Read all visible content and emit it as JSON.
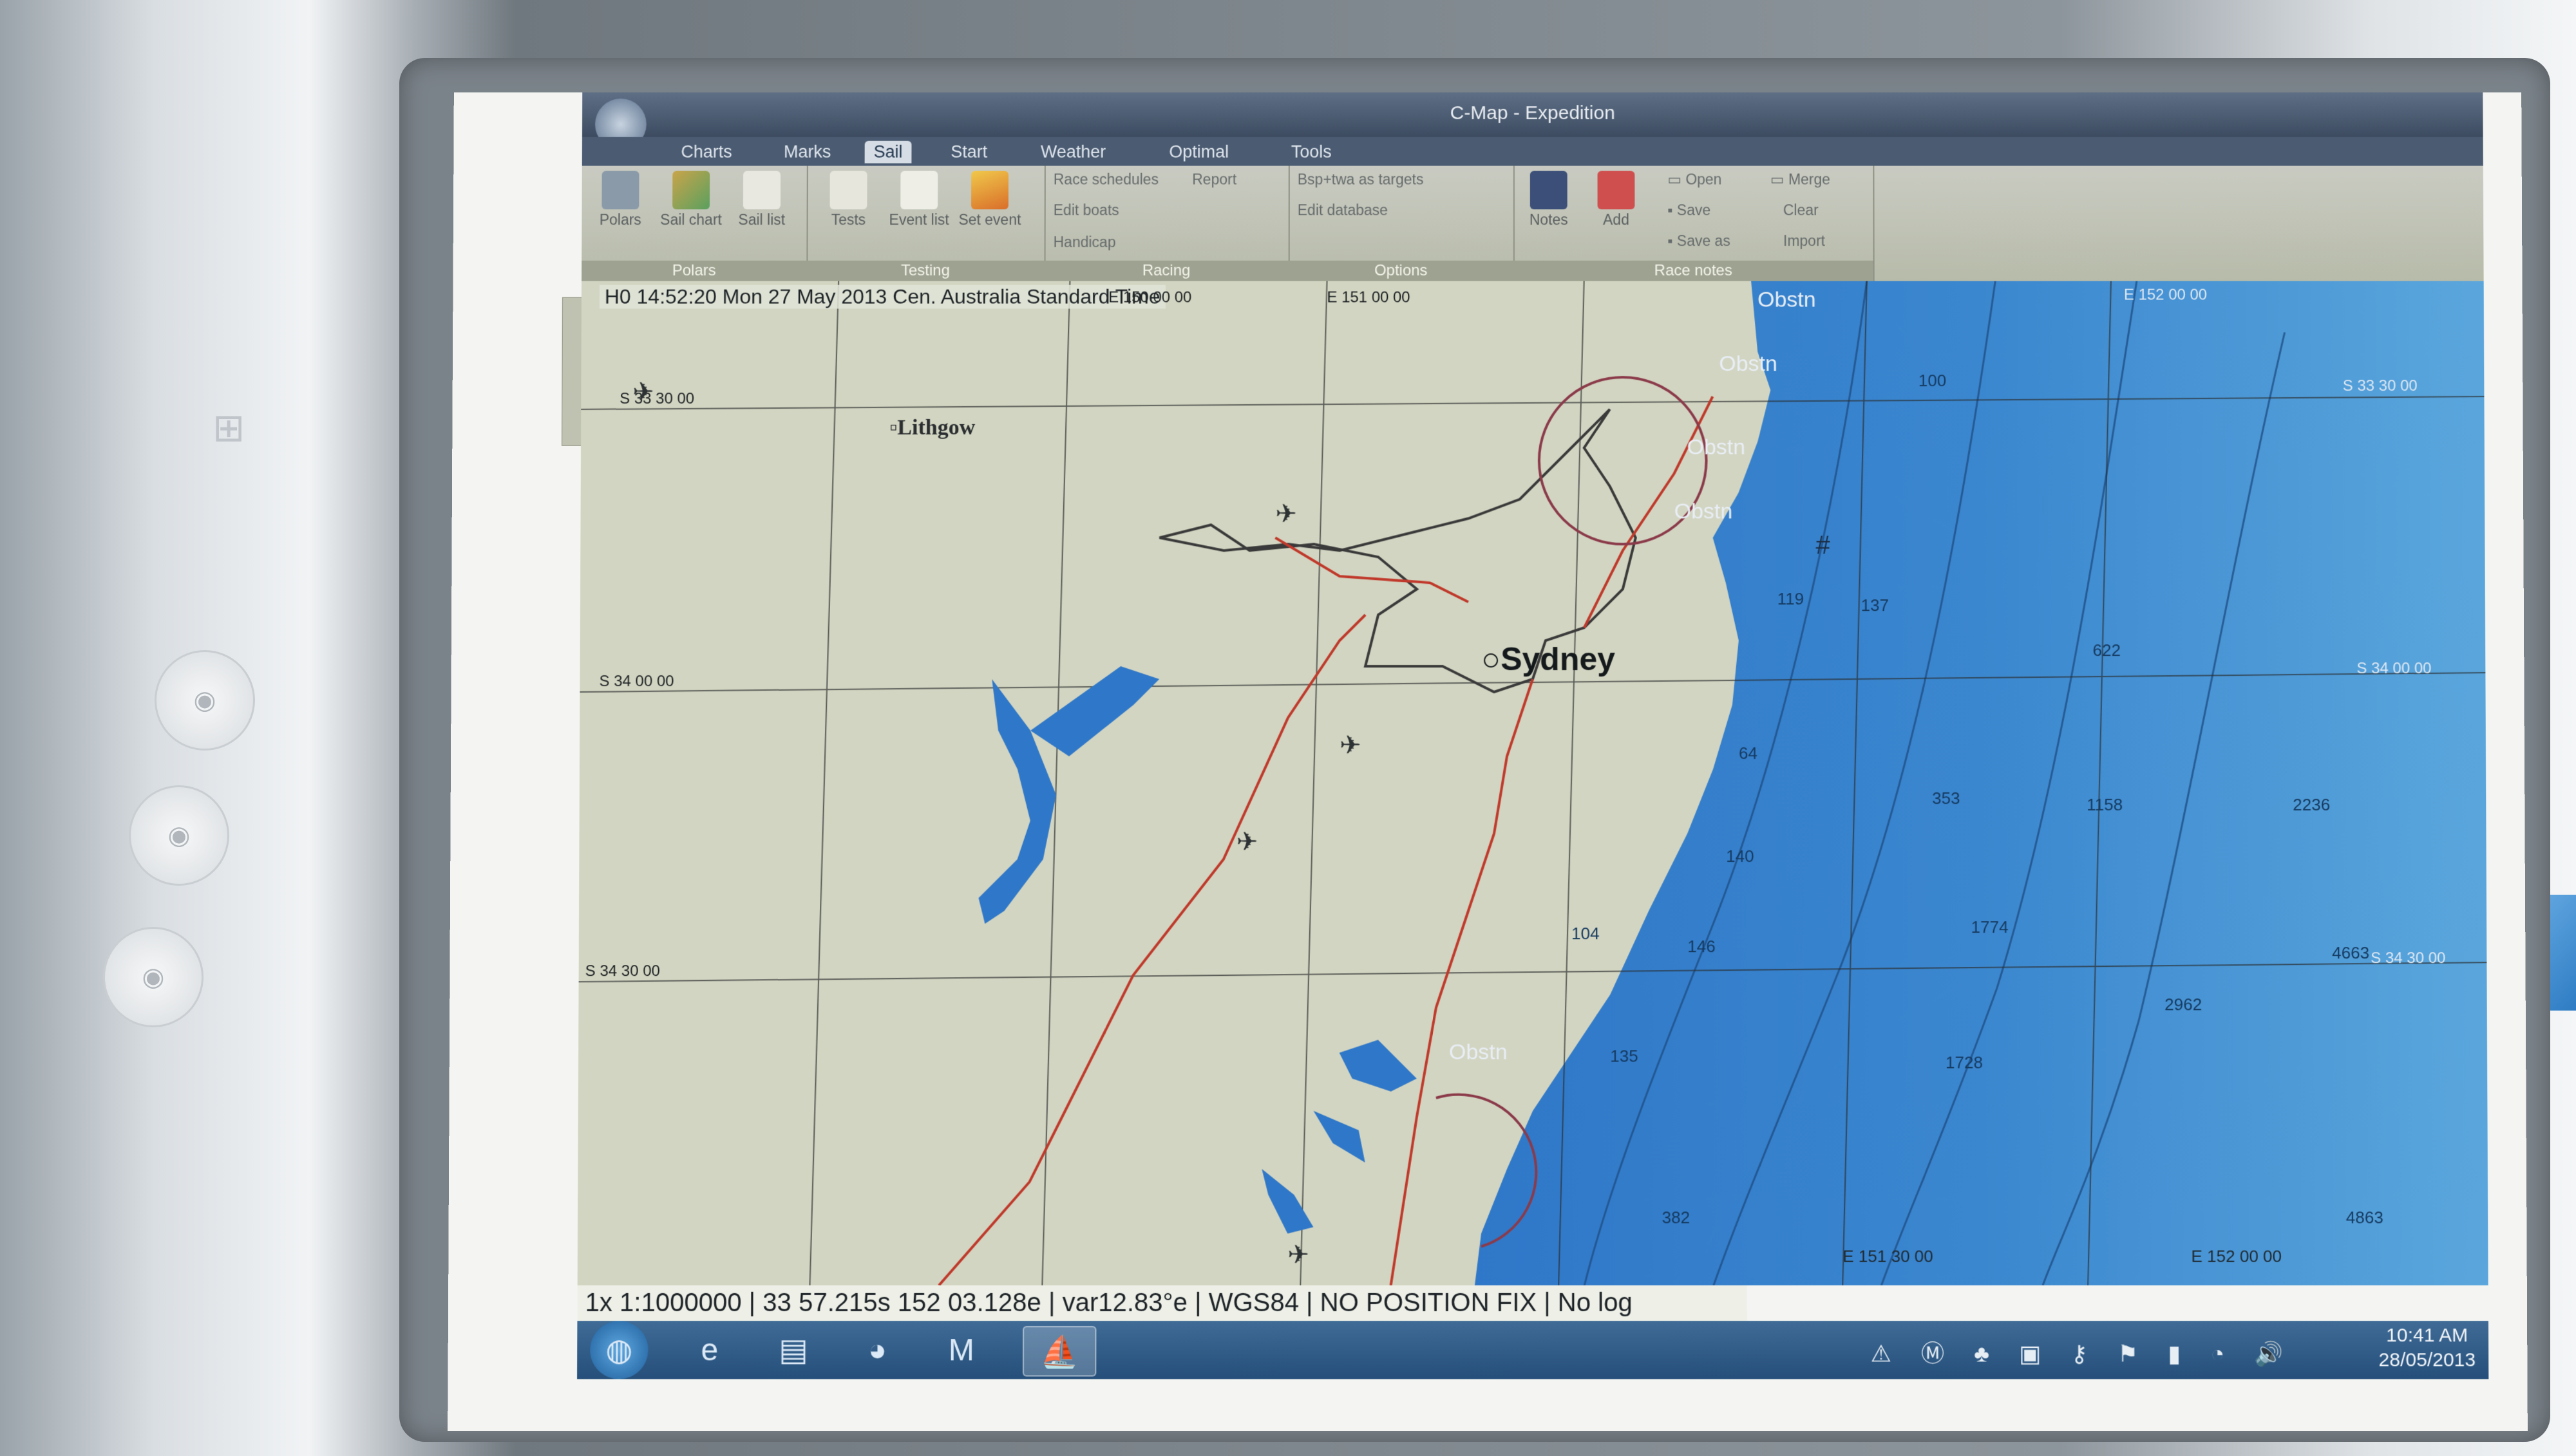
{
  "app": {
    "title": "C-Map - Expedition"
  },
  "tabs": [
    "Charts",
    "Marks",
    "Sail",
    "Start",
    "Weather",
    "Optimal",
    "Tools"
  ],
  "active_tab": "Sail",
  "ribbon": {
    "polars": {
      "buttons": [
        "Polars",
        "Sail chart",
        "Sail list"
      ],
      "label": "Polars"
    },
    "testing": {
      "buttons": [
        "Tests",
        "Event list",
        "Set event"
      ],
      "label": "Testing"
    },
    "racing": {
      "links": [
        "Race schedules",
        "Report",
        "Edit boats",
        "Handicap"
      ],
      "label": "Racing"
    },
    "options": {
      "links": [
        "Bsp+twa as targets",
        "Edit database"
      ],
      "label": "Options"
    },
    "race_notes": {
      "buttons": [
        "Notes",
        "Add"
      ],
      "links": [
        "Open",
        "Save",
        "Save as",
        "Merge",
        "Clear",
        "Import"
      ],
      "label": "Race notes"
    }
  },
  "map": {
    "timestamp": "H0 14:52:20 Mon 27 May 2013 Cen. Australia Standard Time",
    "city_major": "Sydney",
    "city_minor": "Lithgow",
    "obstructions": [
      "Obstn",
      "Obstn",
      "Obstn",
      "Obstn",
      "Obstn"
    ],
    "lat_labels": [
      "S 33 30 00",
      "S 34 00 00",
      "S 34 30 00",
      "S 33 30 00",
      "S 34 00 00",
      "S 34 30 00"
    ],
    "lon_labels": [
      "E 150 00 00",
      "E 151 00 00",
      "E 152 00 00",
      "E 151 30 00",
      "E 152 00 00"
    ],
    "depths": [
      "100",
      "119",
      "137",
      "622",
      "64",
      "353",
      "1158",
      "2236",
      "140",
      "104",
      "146",
      "1774",
      "4663",
      "2962",
      "135",
      "1728",
      "382",
      "4863"
    ]
  },
  "status": {
    "text": "1x 1:1000000 | 33 57.215s 152 03.128e | var12.83°e | WGS84 | NO POSITION FIX | No log"
  },
  "tray": {
    "time": "10:41 AM",
    "date": "28/05/2013"
  },
  "colors": {
    "land": "#d2d5c1",
    "sea_shallow": "#2f77c8",
    "sea_deep": "#4a9ad7",
    "road": "#c0392b",
    "ribbon": "#b7bba9",
    "taskbar": "#254f7a"
  }
}
